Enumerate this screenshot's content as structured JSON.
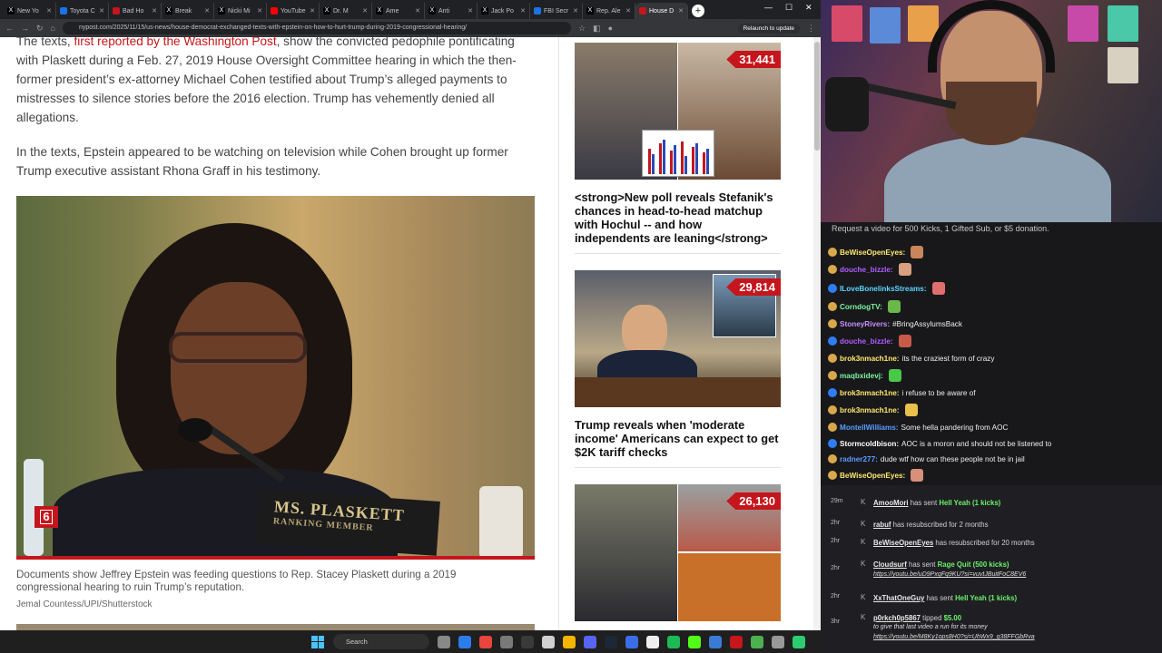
{
  "browser": {
    "tabs": [
      {
        "label": "New Yo",
        "color": "#000000",
        "icon": "x-icon"
      },
      {
        "label": "Toyota C",
        "color": "#1a73e8",
        "icon": "site-icon"
      },
      {
        "label": "Bad Ho",
        "color": "#c4161c",
        "icon": "site-icon"
      },
      {
        "label": "Break",
        "color": "#000000",
        "icon": "x-icon"
      },
      {
        "label": "Nicki Mi",
        "color": "#000000",
        "icon": "x-icon"
      },
      {
        "label": "YouTube",
        "color": "#ff0000",
        "icon": "youtube-icon"
      },
      {
        "label": "Dr. M",
        "color": "#000000",
        "icon": "x-icon"
      },
      {
        "label": "Ame",
        "color": "#000000",
        "icon": "x-icon"
      },
      {
        "label": "Anti",
        "color": "#000000",
        "icon": "x-icon"
      },
      {
        "label": "Jack Po",
        "color": "#000000",
        "icon": "x-icon"
      },
      {
        "label": "FBI Secr",
        "color": "#1a73e8",
        "icon": "site-icon"
      },
      {
        "label": "Rep. Ale",
        "color": "#000000",
        "icon": "x-icon"
      },
      {
        "label": "House D",
        "color": "#c4161c",
        "icon": "site-icon",
        "active": true
      }
    ],
    "url": "nypost.com/2025/11/15/us-news/house-democrat-exchanged-texts-with-epstein-on-how-to-hurt-trump-during-2019-congressional-hearing/",
    "relaunch_label": "Relaunch to update"
  },
  "article": {
    "para1_prefix": "The texts, ",
    "para1_link": "first reported by the Washington Post",
    "para1_rest": ", show the convicted pedophile pontificating with Plaskett during a Feb. 27, 2019 House Oversight Committee hearing in which the then-former president’s ex-attorney Michael Cohen testified about Trump’s alleged payments to mistresses to silence stories before the 2016 election. Trump has vehemently denied all allegations.",
    "para2": "In the texts, Epstein appeared to be watching on television while Cohen brought up former Trump executive assistant Rhona Graff in his testimony.",
    "gallery_count": "6",
    "nameplate": "MS. PLASKETT",
    "nameplate_sub": "RANKING MEMBER",
    "caption": "Documents show Jeffrey Epstein was feeding questions to Rep. Stacey Plaskett during a 2019 congressional hearing to ruin Trump’s reputation.",
    "credit": "Jemal Countess/UPI/Shutterstock"
  },
  "sidebar": [
    {
      "count": "31,441",
      "headline": "<strong>New poll reveals Stefanik's chances in head-to-head matchup with Hochul -- and how independents are leaning</strong>"
    },
    {
      "count": "29,814",
      "headline": "Trump reveals when 'moderate income' Americans can expect to get $2K tariff checks"
    },
    {
      "count": "26,130",
      "headline": ""
    }
  ],
  "taskbar": {
    "search_label": "Search"
  },
  "chat": {
    "header": "Request a video for 500 Kicks, 1 Gifted Sub, or $5 donation.",
    "messages": [
      {
        "user": "BeWiseOpenEyes:",
        "text": "",
        "color": "#ffe96b"
      },
      {
        "user": "douche_bizzle:",
        "text": "",
        "color": "#b45cff"
      },
      {
        "user": "ILoveBonelinksStreams:",
        "text": "",
        "color": "#5ad6ff"
      },
      {
        "user": "CorndogTV:",
        "text": "",
        "color": "#7cf5a0"
      },
      {
        "user": "StoneyRivers:",
        "text": "#BringAssylumsBack",
        "color": "#c98cff"
      },
      {
        "user": "douche_bizzle:",
        "text": "",
        "color": "#b45cff"
      },
      {
        "user": "brok3nmach1ne:",
        "text": "its the craziest form of crazy",
        "color": "#ffe96b"
      },
      {
        "user": "maqbxidevj:",
        "text": "",
        "color": "#7cf5a0"
      },
      {
        "user": "brok3nmach1ne:",
        "text": "i refuse to be aware of",
        "color": "#ffe96b"
      },
      {
        "user": "brok3nmach1ne:",
        "text": "",
        "color": "#ffe96b"
      },
      {
        "user": "MontellWilliams:",
        "text": "Some hella pandering from AOC",
        "color": "#5a9cff"
      },
      {
        "user": "Stormcoldbison:",
        "text": "AOC is a moron and should not be listened to",
        "color": "#ffffff"
      },
      {
        "user": "radner277:",
        "text": "dude wtf how can these people not be in jail",
        "color": "#5a9cff"
      },
      {
        "user": "BeWiseOpenEyes:",
        "text": "",
        "color": "#ffe96b"
      }
    ]
  },
  "alerts": [
    {
      "time": "29m",
      "user": "AmooMori",
      "mid": " has sent ",
      "gift": "Hell Yeah (1 kicks)",
      "note": "",
      "link": ""
    },
    {
      "time": "2hr",
      "user": "rabuf",
      "mid": " has resubscribed for 2 months",
      "gift": "",
      "note": "",
      "link": ""
    },
    {
      "time": "2hr",
      "user": "BeWiseOpenEyes",
      "mid": " has resubscribed for 20 months",
      "gift": "",
      "note": "",
      "link": ""
    },
    {
      "time": "2hr",
      "user": "Cloudsurf",
      "mid": " has sent ",
      "gift": "Rage Quit (500 kicks)",
      "note": "",
      "link": "https://youtu.be/uD9PxqFq9KU?si=vuvtJBuitFoC8EV6"
    },
    {
      "time": "2hr",
      "user": "XxThatOneGuy",
      "mid": " has sent ",
      "gift": "Hell Yeah (1 kicks)",
      "note": "",
      "link": ""
    },
    {
      "time": "3hr",
      "user": "p0rkch0p5867",
      "mid": " tipped ",
      "gift": "$5.00",
      "note": "to give that last video a run for its money",
      "link": "https://youtu.be/M8Ky1ops8H0?si=UhWx9_g38FFGbRva"
    }
  ]
}
